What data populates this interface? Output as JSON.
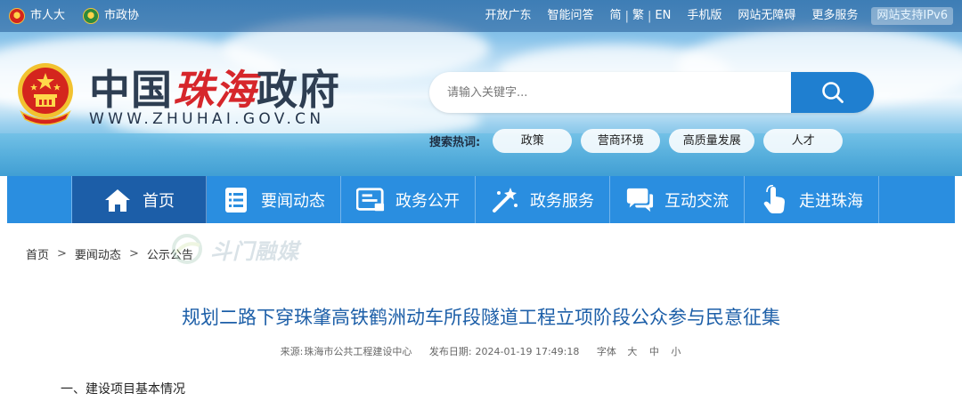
{
  "topbar": {
    "left_links": [
      {
        "label": "市人大",
        "icon": "people-congress-emblem-icon"
      },
      {
        "label": "市政协",
        "icon": "cppcc-emblem-icon"
      }
    ],
    "right_links": [
      "开放广东",
      "智能问答",
      "简",
      "繁",
      "EN",
      "手机版",
      "网站无障碍",
      "更多服务"
    ],
    "ipv6_badge": "网站支持IPv6"
  },
  "logo": {
    "title_prefix": "中国",
    "title_accent": "珠海",
    "title_suffix": "政府",
    "url": "WWW.ZHUHAI.GOV.CN",
    "emblem_icon": "national-emblem-icon"
  },
  "search": {
    "placeholder": "请输入关键字...",
    "value": "",
    "button_icon": "search-icon",
    "hot_label": "搜索热词:",
    "hot_words": [
      "政策",
      "营商环境",
      "高质量发展",
      "人才"
    ]
  },
  "nav": {
    "items": [
      {
        "label": "首页",
        "icon": "home-icon",
        "active": true
      },
      {
        "label": "要闻动态",
        "icon": "news-list-icon",
        "active": false
      },
      {
        "label": "政务公开",
        "icon": "document-icon",
        "active": false
      },
      {
        "label": "政务服务",
        "icon": "magic-wand-icon",
        "active": false
      },
      {
        "label": "互动交流",
        "icon": "chat-bubble-icon",
        "active": false
      },
      {
        "label": "走进珠海",
        "icon": "hand-pointer-icon",
        "active": false
      }
    ]
  },
  "breadcrumb": {
    "items": [
      "首页",
      "要闻动态",
      "公示公告"
    ],
    "separator": ">"
  },
  "watermark": {
    "text": "斗门融媒"
  },
  "article": {
    "title": "规划二路下穿珠肇高铁鹤洲动车所段隧道工程立项阶段公众参与民意征集",
    "source_label": "来源:",
    "source": "珠海市公共工程建设中心",
    "date_label": "发布日期:",
    "date": "2024-01-19 17:49:18",
    "font_label": "字体",
    "font_sizes": [
      "大",
      "中",
      "小"
    ],
    "section_heading": "一、建设项目基本情况"
  },
  "colors": {
    "nav_bg": "#2a8ee0",
    "nav_active_bg": "#1c5ea8",
    "title_blue": "#1d5fa8",
    "accent_red": "#d6262b",
    "search_button": "#1f7fd0"
  }
}
